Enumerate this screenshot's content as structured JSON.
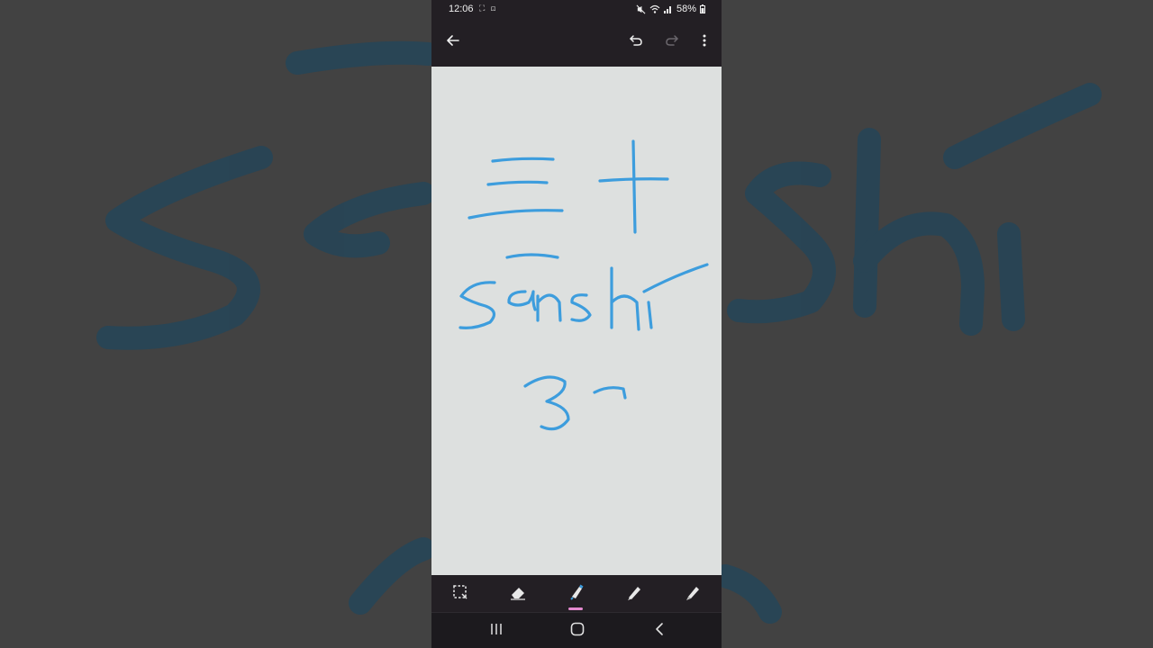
{
  "status_bar": {
    "time": "12:06",
    "notification_icons": "⛶ ⊡",
    "battery": "58%"
  },
  "app_bar": {
    "back_icon": "arrow-left-icon",
    "undo_icon": "undo-icon",
    "redo_icon": "redo-icon",
    "more_icon": "more-vert-icon"
  },
  "drawing": {
    "ink_color": "#3d9ddd",
    "canvas_color": "#dde0df"
  },
  "toolbar": {
    "tools": [
      "selection-tool",
      "eraser-tool",
      "highlighter-tool",
      "pen-tool",
      "pencil-tool"
    ],
    "active_tool": "highlighter-tool",
    "indicator_color": "#e58ad0"
  },
  "nav_bar": {
    "buttons": [
      "recents-button",
      "home-button",
      "back-button"
    ]
  }
}
